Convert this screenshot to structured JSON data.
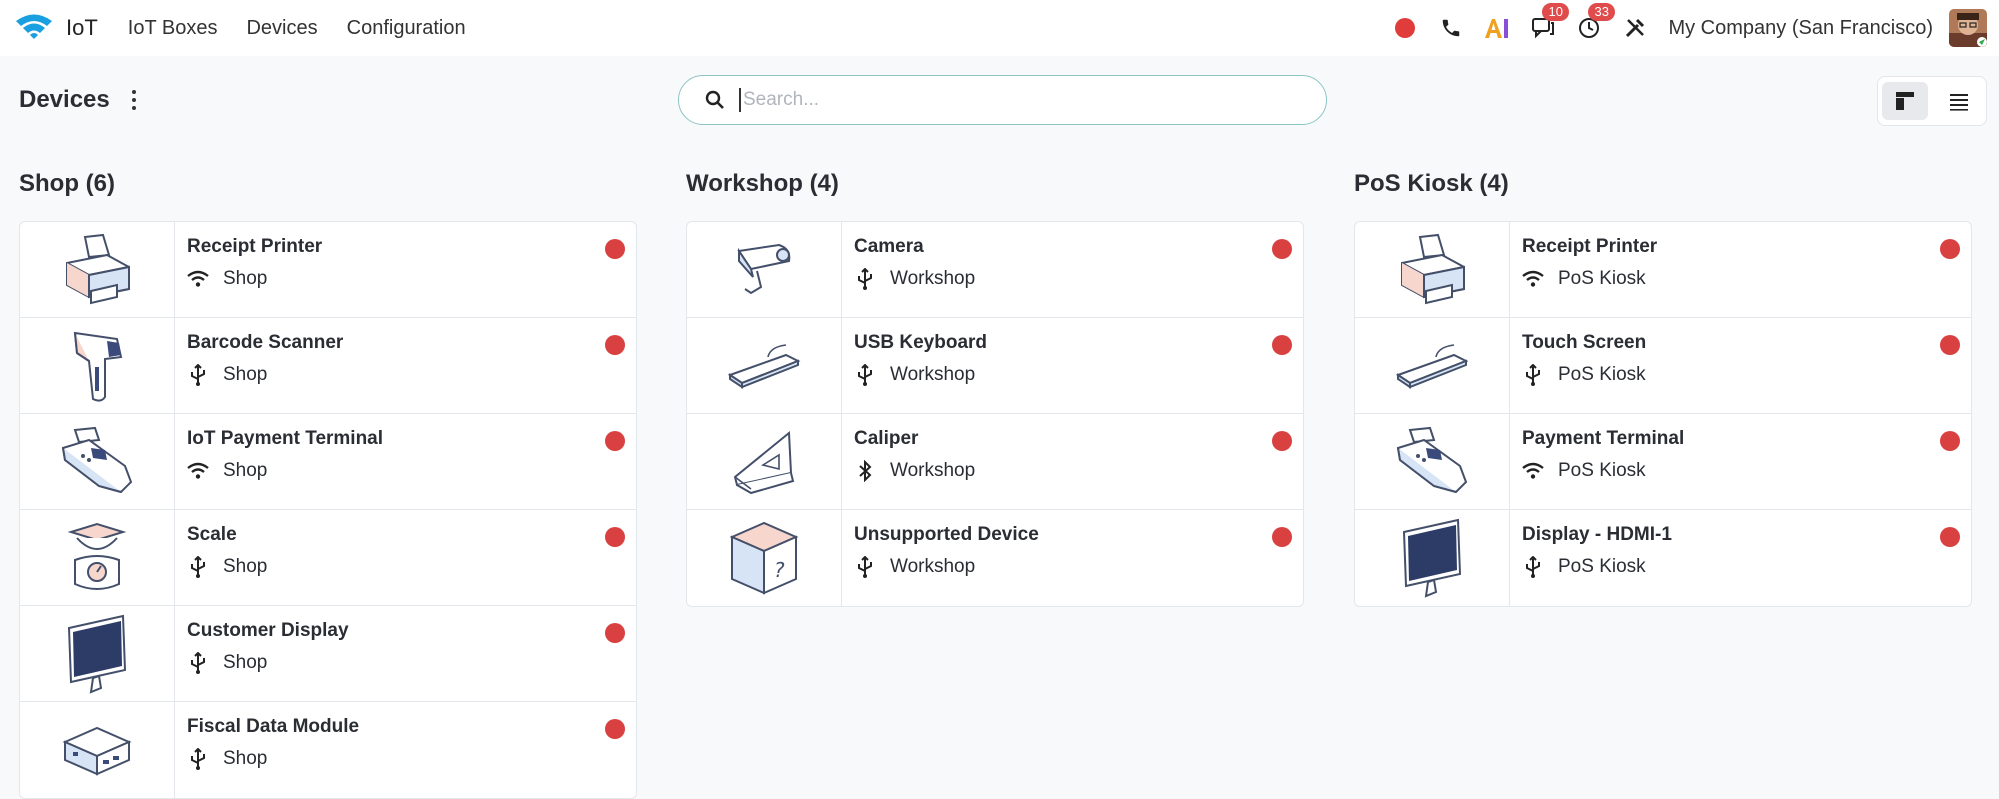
{
  "navbar": {
    "app_name": "IoT",
    "menu": [
      "IoT Boxes",
      "Devices",
      "Configuration"
    ],
    "systray": {
      "messages_badge": "10",
      "activities_badge": "33",
      "company": "My Company (San Francisco)"
    }
  },
  "control_panel": {
    "title": "Devices",
    "search_placeholder": "Search..."
  },
  "columns": [
    {
      "title": "Shop (6)",
      "devices": [
        {
          "name": "Receipt Printer",
          "location": "Shop",
          "connection": "wifi-icon",
          "image": "printer"
        },
        {
          "name": "Barcode Scanner",
          "location": "Shop",
          "connection": "usb-icon",
          "image": "scanner"
        },
        {
          "name": "IoT Payment Terminal",
          "location": "Shop",
          "connection": "wifi-icon",
          "image": "payment"
        },
        {
          "name": "Scale",
          "location": "Shop",
          "connection": "usb-icon",
          "image": "scale"
        },
        {
          "name": "Customer Display",
          "location": "Shop",
          "connection": "usb-icon",
          "image": "display"
        },
        {
          "name": "Fiscal Data Module",
          "location": "Shop",
          "connection": "usb-icon",
          "image": "fiscal"
        }
      ]
    },
    {
      "title": "Workshop (4)",
      "devices": [
        {
          "name": "Camera",
          "location": "Workshop",
          "connection": "usb-icon",
          "image": "camera"
        },
        {
          "name": "USB Keyboard",
          "location": "Workshop",
          "connection": "usb-icon",
          "image": "keyboard"
        },
        {
          "name": "Caliper",
          "location": "Workshop",
          "connection": "bluetooth-icon",
          "image": "caliper"
        },
        {
          "name": "Unsupported Device",
          "location": "Workshop",
          "connection": "usb-icon",
          "image": "unknown"
        }
      ]
    },
    {
      "title": "PoS Kiosk (4)",
      "devices": [
        {
          "name": "Receipt Printer",
          "location": "PoS Kiosk",
          "connection": "wifi-icon",
          "image": "printer"
        },
        {
          "name": "Touch Screen",
          "location": "PoS Kiosk",
          "connection": "usb-icon",
          "image": "keyboard"
        },
        {
          "name": "Payment Terminal",
          "location": "PoS Kiosk",
          "connection": "wifi-icon",
          "image": "payment"
        },
        {
          "name": "Display - HDMI-1",
          "location": "PoS Kiosk",
          "connection": "usb-icon",
          "image": "display"
        }
      ]
    }
  ],
  "colors": {
    "accent": "#8cc5c3",
    "status_offline": "#d94141",
    "badge": "#e04b4b"
  }
}
